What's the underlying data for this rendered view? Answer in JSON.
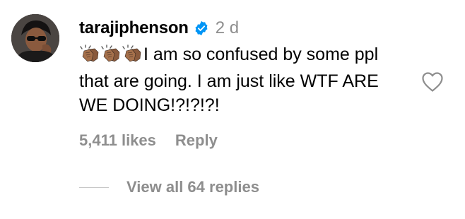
{
  "comment": {
    "username": "tarajiphenson",
    "verified": true,
    "timestamp": "2 d",
    "emoji": [
      "clapping-hands-medium-dark-skin",
      "clapping-hands-medium-dark-skin",
      "clapping-hands-medium-dark-skin"
    ],
    "text": "I am so confused by some ppl that are going. I am just like WTF ARE WE DOING!?!?!?!",
    "likes_label": "5,411 likes",
    "reply_label": "Reply",
    "view_replies_label": "View all 64 replies",
    "liked": false
  },
  "colors": {
    "text": "#000000",
    "secondary": "#8e8e8e",
    "verified_badge": "#0095f6",
    "divider": "#c7c7c7"
  },
  "icons": {
    "verified": "verified-badge-icon",
    "like": "heart-outline-icon",
    "emoji": "clapping-hands-emoji"
  }
}
